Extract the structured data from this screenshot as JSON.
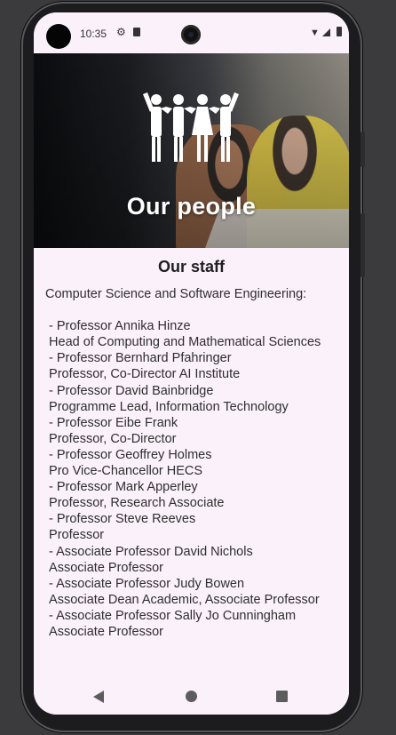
{
  "status_bar": {
    "time": "10:35",
    "icons": [
      "gear-icon",
      "sd-card-icon",
      "wifi-icon",
      "signal-icon",
      "battery-icon"
    ]
  },
  "hero": {
    "title": "Our people",
    "icon": "people-group-icon"
  },
  "main": {
    "title": "Our staff",
    "staff_text": "Computer Science and Software Engineering:\n\n - Professor Annika Hinze\n Head of Computing and Mathematical Sciences\n - Professor Bernhard Pfahringer\n Professor, Co-Director AI Institute\n - Professor David Bainbridge\n Programme Lead, Information Technology\n - Professor Eibe Frank\n Professor, Co-Director\n - Professor Geoffrey Holmes\n Pro Vice-Chancellor HECS\n - Professor Mark Apperley\n Professor, Research Associate\n - Professor Steve Reeves\n Professor\n - Associate Professor David Nichols\n Associate Professor\n - Associate Professor Judy Bowen\n Associate Dean Academic, Associate Professor\n - Associate Professor Sally Jo Cunningham\n Associate Professor"
  },
  "nav_bar": {
    "buttons": [
      "back-icon",
      "home-icon",
      "recents-icon"
    ]
  }
}
